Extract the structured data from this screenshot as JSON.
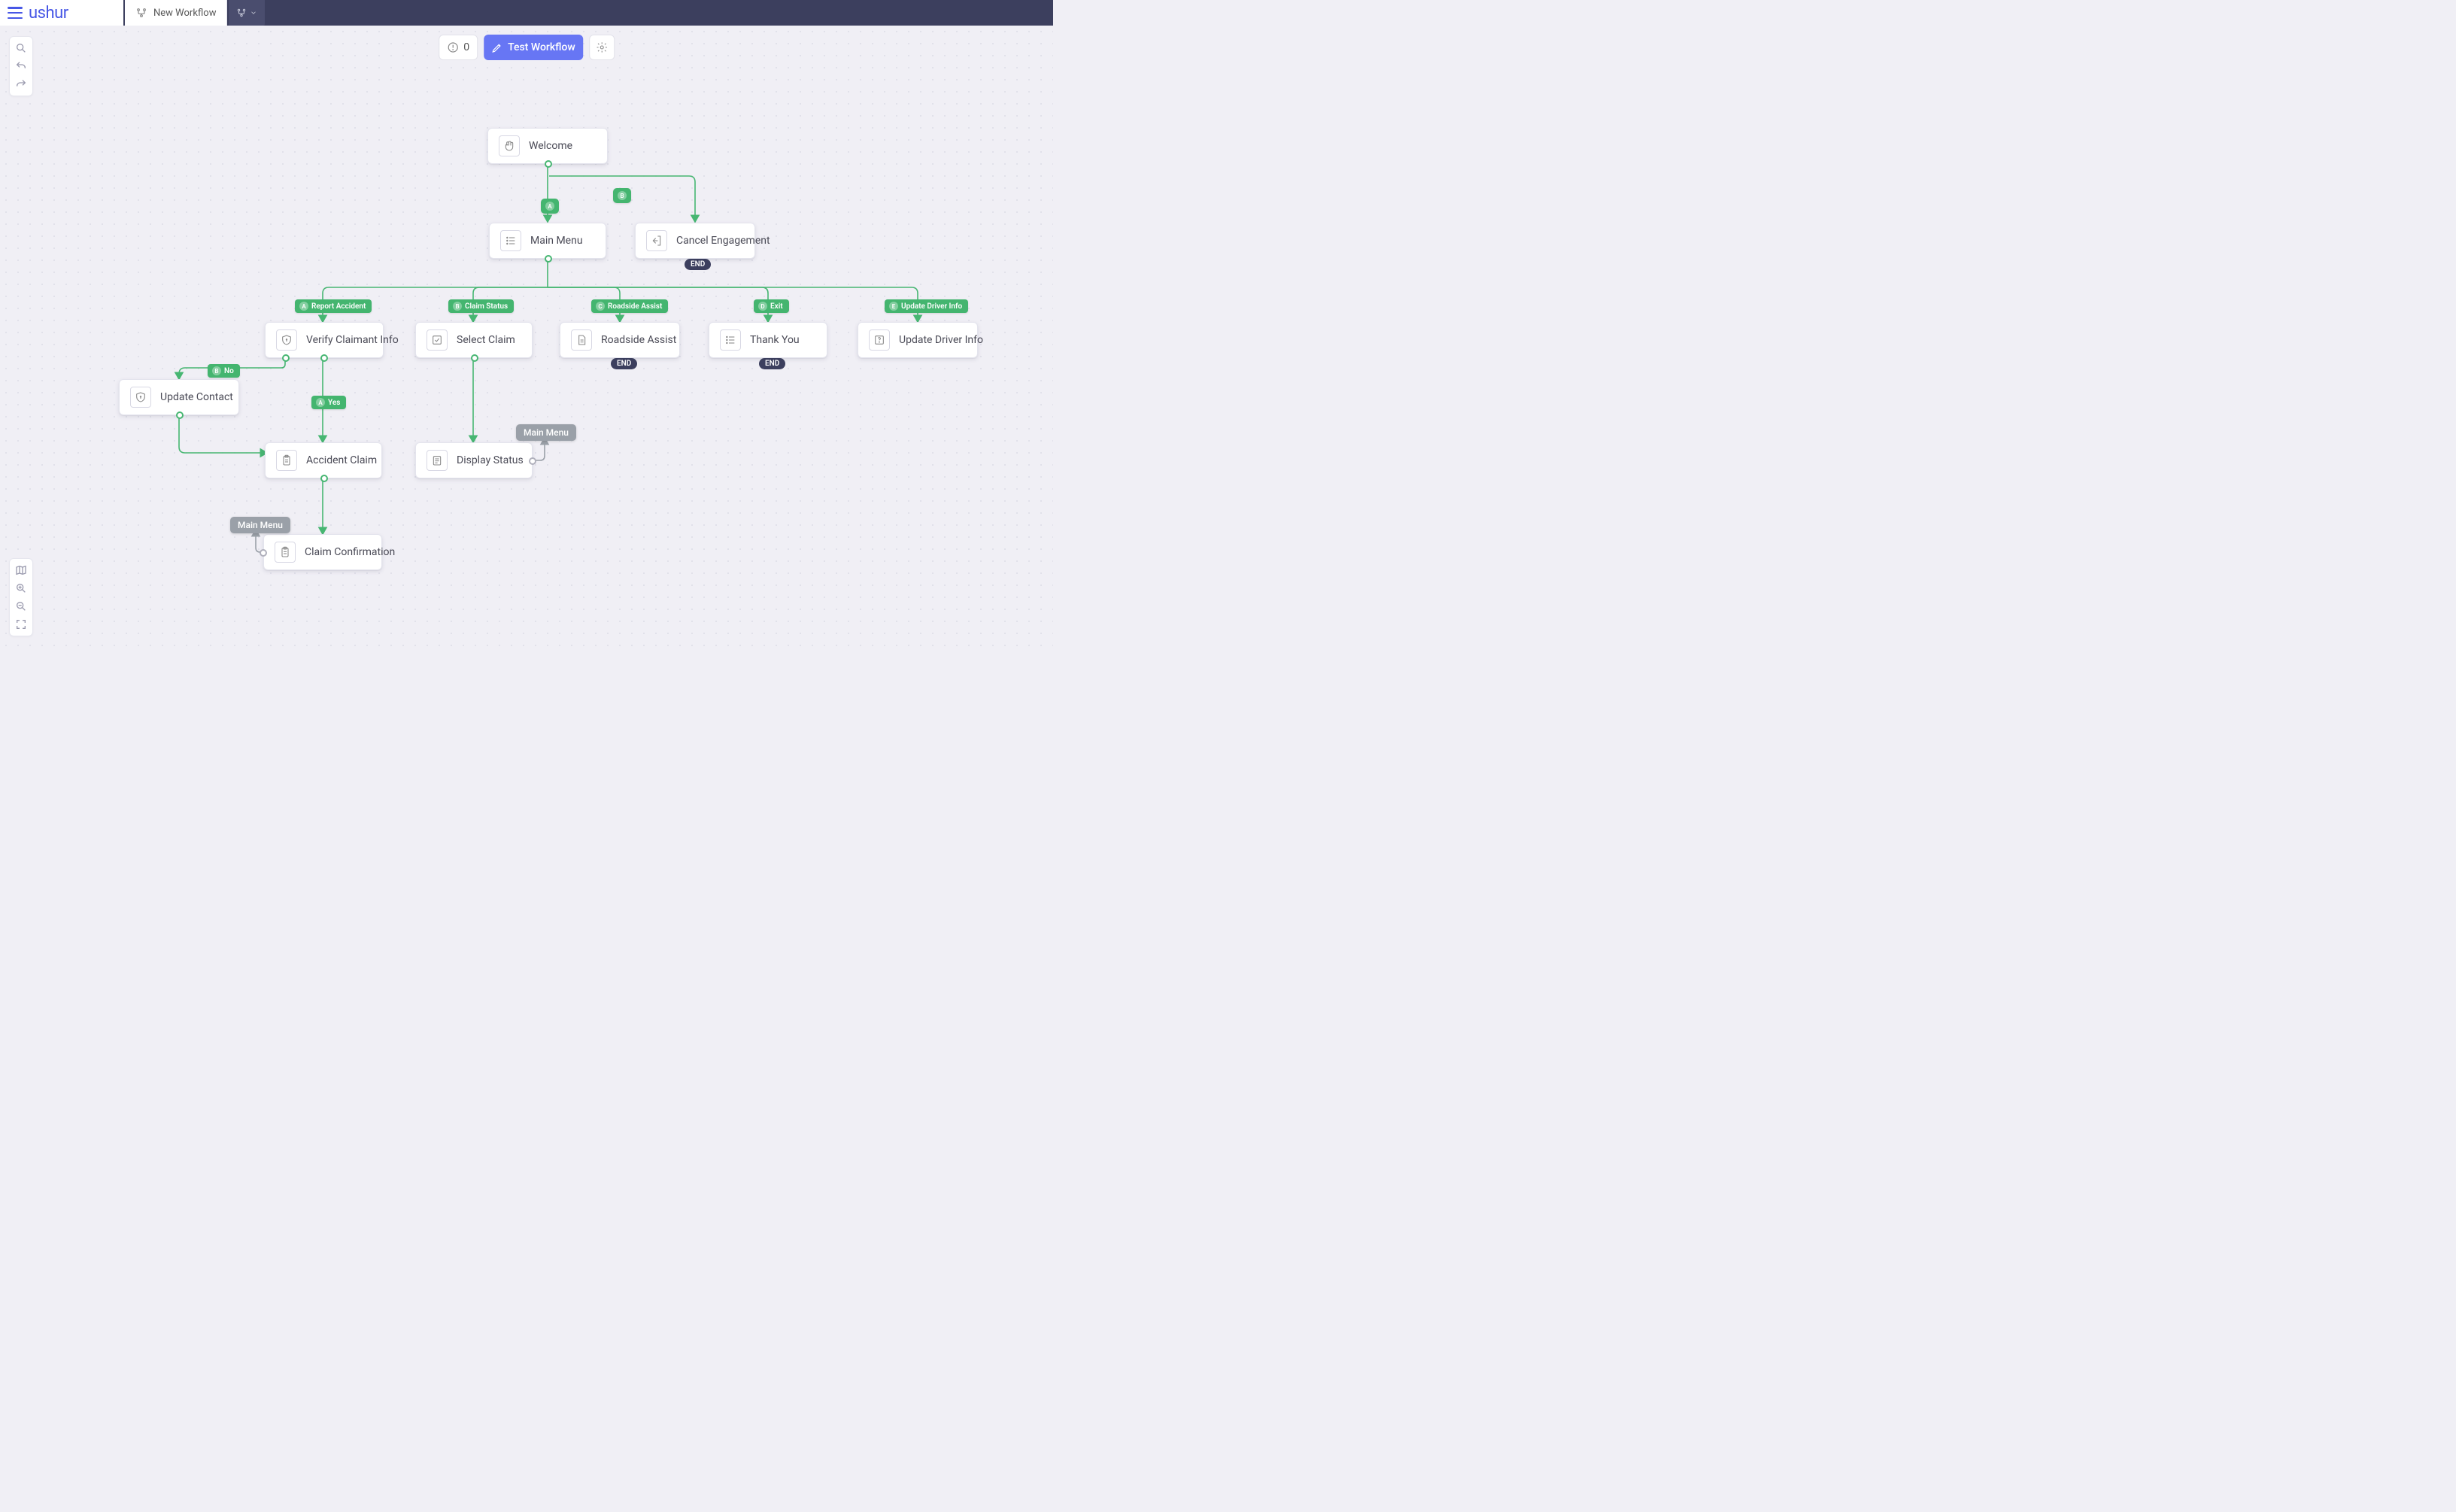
{
  "brand": "ushur",
  "tab": {
    "label": "New Workflow"
  },
  "toolbar": {
    "errors": "0",
    "test": "Test Workflow"
  },
  "nodes": {
    "welcome": "Welcome",
    "mainmenu": "Main Menu",
    "cancelEngagement": "Cancel Engagement",
    "verifyClaimant": "Verify Claimant Info",
    "selectClaim": "Select Claim",
    "roadsideAssist": "Roadside Assist",
    "thankyou": "Thank You",
    "updateDriver": "Update Driver Info",
    "updateContact": "Update Contact",
    "accidentClaim": "Accident Claim",
    "displayStatus": "Display Status",
    "claimConfirmation": "Claim Confirmation"
  },
  "badges": {
    "end": "END"
  },
  "edgeLabels": {
    "a": "A",
    "b": "B",
    "reportAccident": "Report Accident",
    "claimStatus": "Claim Status",
    "roadsideAssist": "Roadside Assist",
    "exit": "Exit",
    "updateDriverInfo": "Update Driver Info",
    "no": "No",
    "yes": "Yes"
  },
  "returnLabels": {
    "mainmenu1": "Main Menu",
    "mainmenu2": "Main Menu"
  }
}
